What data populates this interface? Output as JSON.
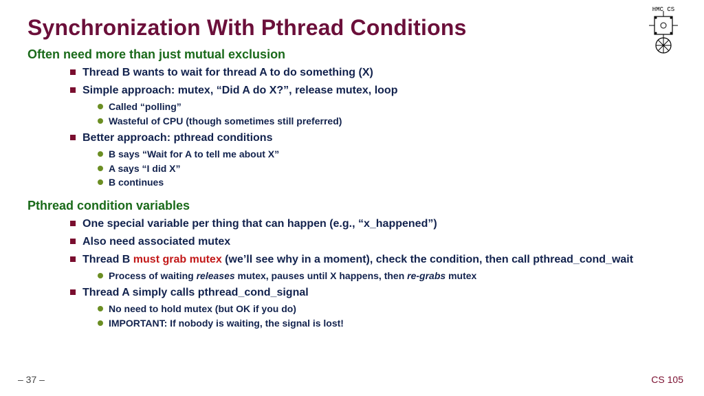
{
  "logo_text": "HMC CS",
  "title": "Synchronization With Pthread Conditions",
  "sections": [
    {
      "heading": "Often need more than just mutual exclusion",
      "items": [
        {
          "pre": "Thread B wants to wait for thread A to do something (X)"
        },
        {
          "pre": "Simple approach: mutex, “Did A do X?”, release mutex, loop",
          "sub": [
            {
              "t": "Called “polling”"
            },
            {
              "t": "Wasteful of CPU (though sometimes still preferred)"
            }
          ]
        },
        {
          "pre": "Better approach: pthread conditions",
          "sub": [
            {
              "t": "B says “Wait for A to tell me about X”"
            },
            {
              "t": "A says “I did X”"
            },
            {
              "t": "B continues"
            }
          ]
        }
      ]
    },
    {
      "heading": "Pthread condition variables",
      "items": [
        {
          "pre": "One special variable per thing that can happen (e.g., “x_happened”)"
        },
        {
          "pre": "Also need associated mutex"
        },
        {
          "pre": "Thread B ",
          "red": "must grab mutex",
          "post": " (we’ll see why in a moment), check the condition, then call pthread_cond_wait",
          "sub": [
            {
              "t_pre": "Process of waiting ",
              "em1": "releases",
              "t_mid": " mutex, pauses until X happens, then ",
              "em2": "re-grabs",
              "t_post": " mutex"
            }
          ]
        },
        {
          "pre": "Thread A simply calls pthread_cond_signal",
          "sub": [
            {
              "t": "No need to hold mutex (but OK if you do)"
            },
            {
              "t": "IMPORTANT: If nobody is waiting, the signal is lost!"
            }
          ]
        }
      ]
    }
  ],
  "page_number": "– 37 –",
  "course": "CS 105"
}
